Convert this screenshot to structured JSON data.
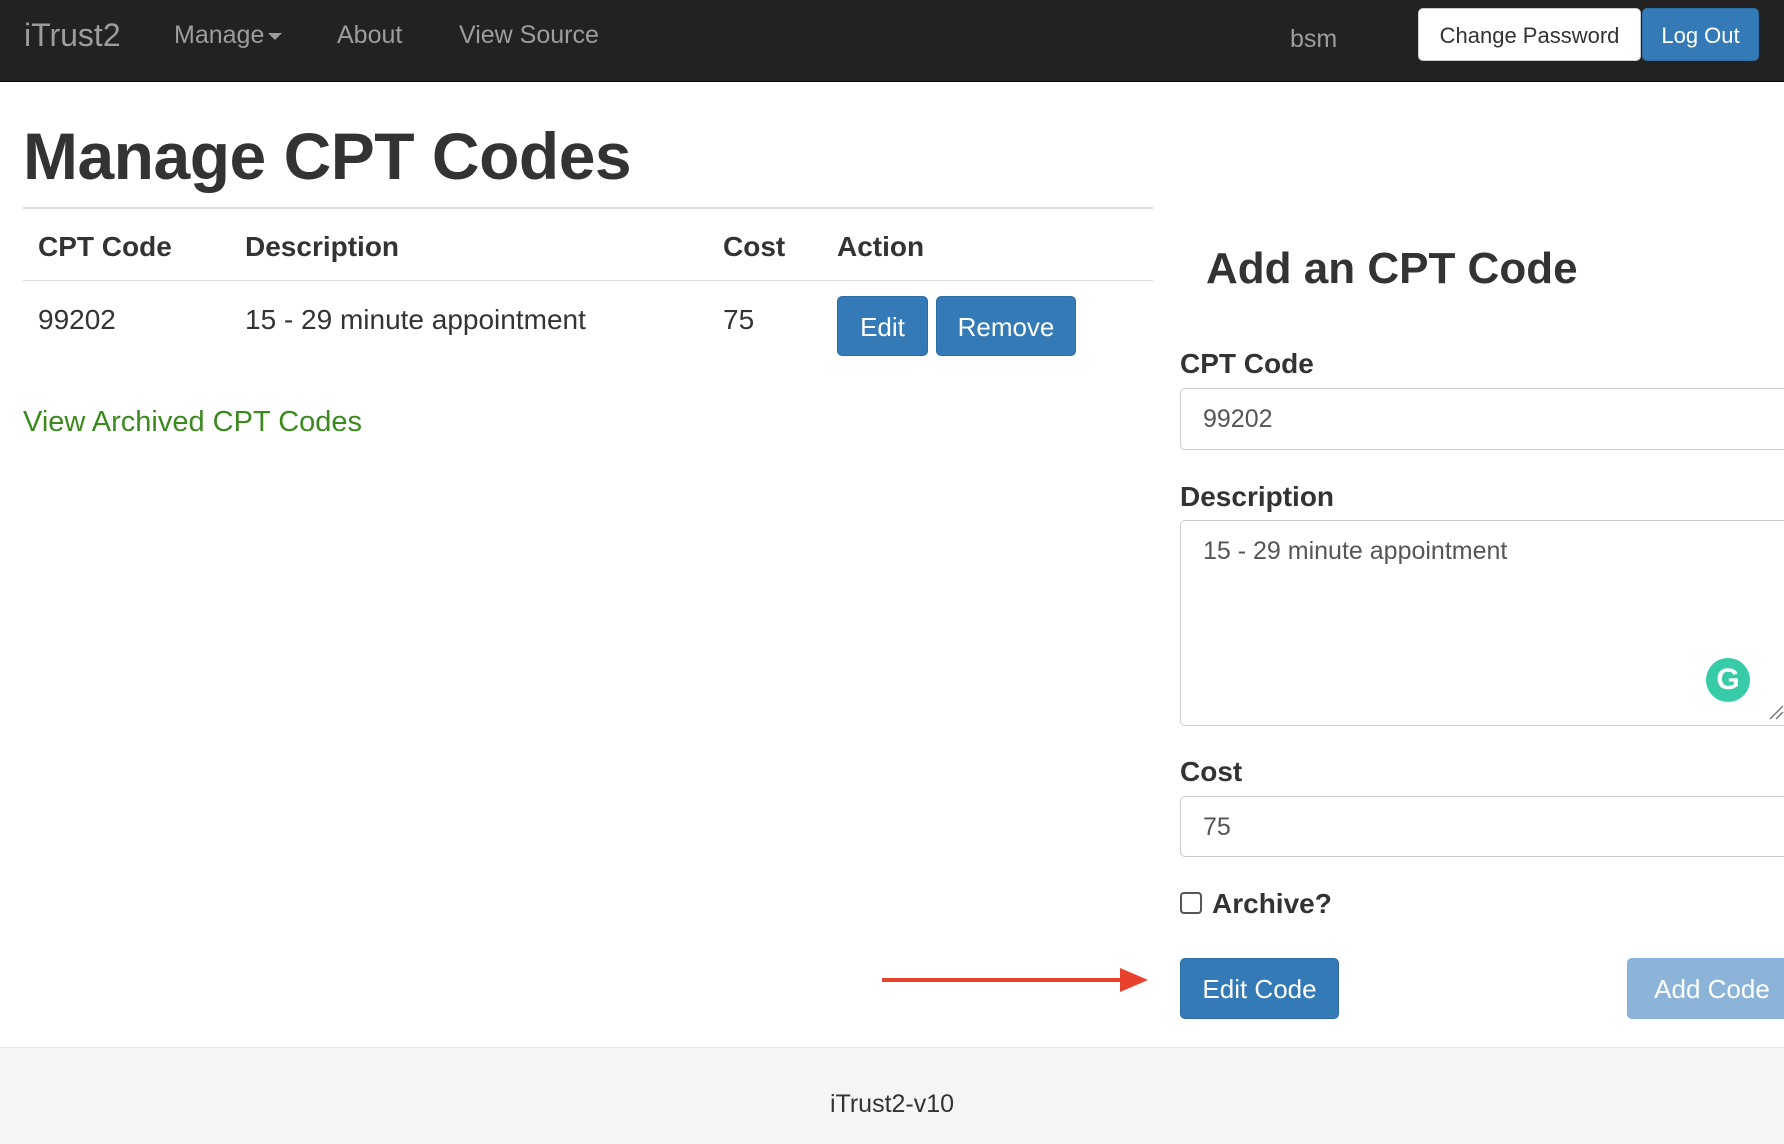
{
  "navbar": {
    "brand": "iTrust2",
    "manage_label": "Manage",
    "about_label": "About",
    "view_source_label": "View Source",
    "username": "bsm",
    "change_password_label": "Change Password",
    "logout_label": "Log Out"
  },
  "page": {
    "title": "Manage CPT Codes"
  },
  "table": {
    "headers": [
      "CPT Code",
      "Description",
      "Cost",
      "Action"
    ],
    "rows": [
      {
        "code": "99202",
        "description": "15 - 29 minute appointment",
        "cost": "75",
        "edit_label": "Edit",
        "remove_label": "Remove"
      }
    ]
  },
  "archived_link": "View Archived CPT Codes",
  "form": {
    "title": "Add an CPT Code",
    "code_label": "CPT Code",
    "code_value": "99202",
    "description_label": "Description",
    "description_value": "15 - 29 minute appointment",
    "cost_label": "Cost",
    "cost_value": "75",
    "archive_label": "Archive?",
    "archive_checked": false,
    "edit_button": "Edit Code",
    "add_button": "Add Code",
    "grammarly_badge": "G"
  },
  "colors": {
    "navbar_bg": "#222222",
    "primary": "#337ab7",
    "primary_disabled": "#8cb4d9",
    "link_green": "#3c8a1f",
    "annotation_arrow": "#e8412c"
  },
  "footer": {
    "text": "iTrust2-v10"
  }
}
